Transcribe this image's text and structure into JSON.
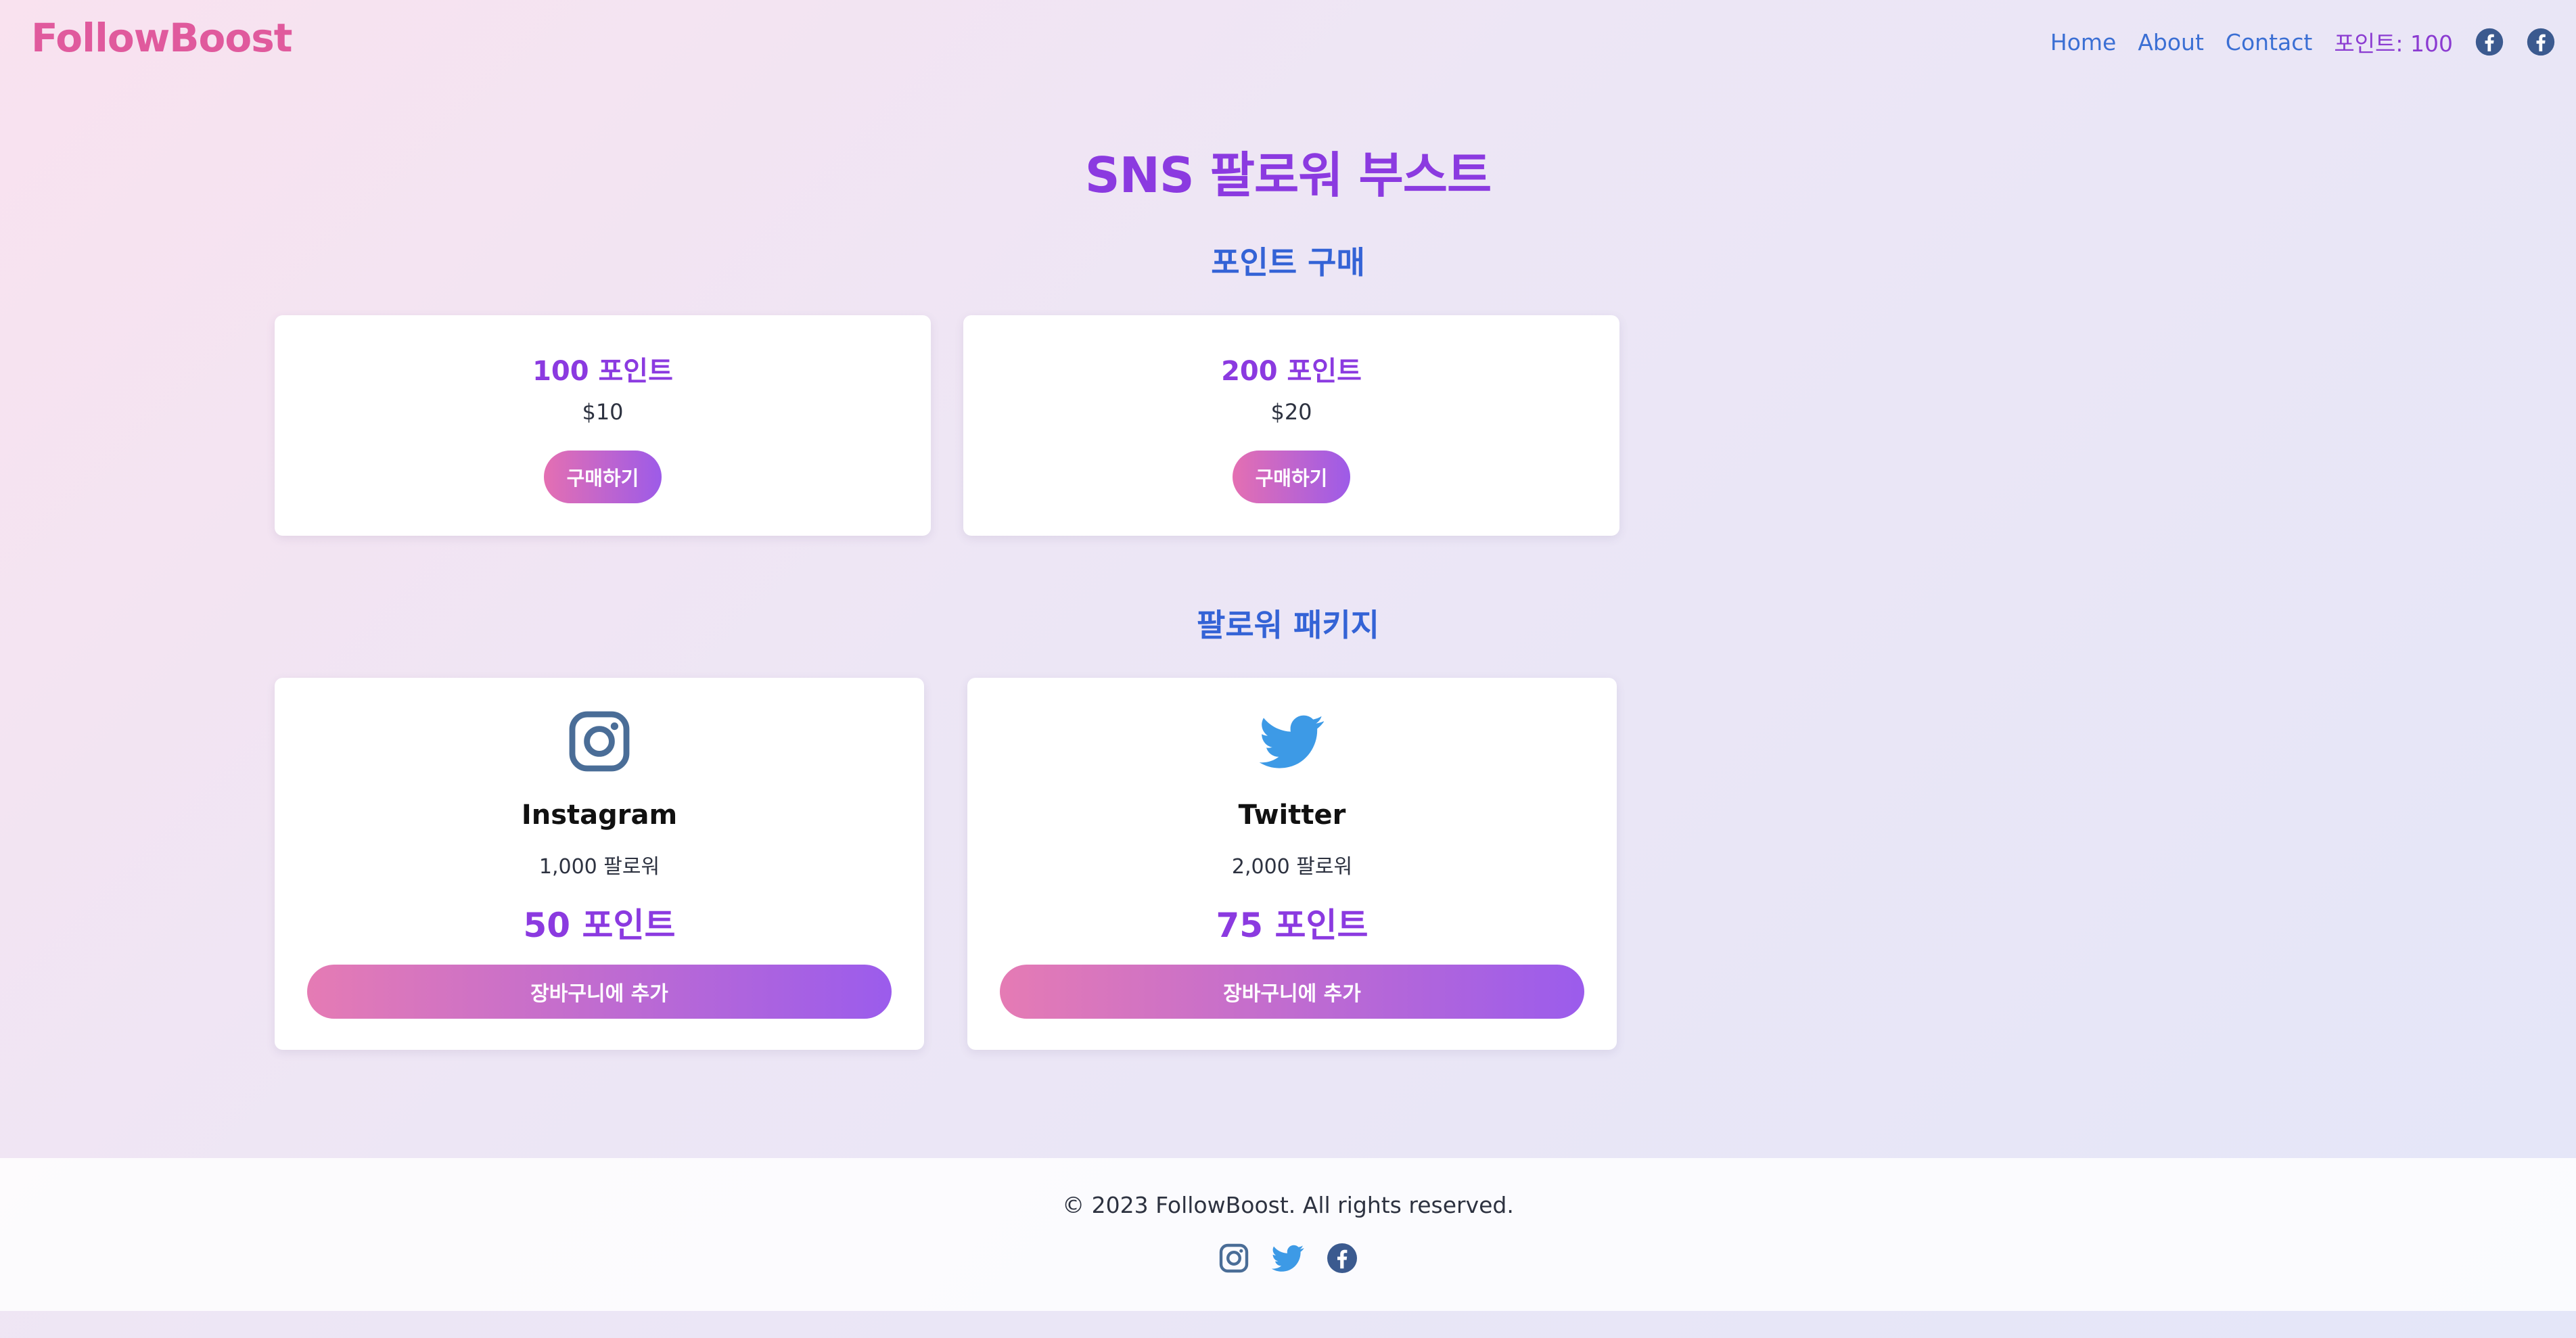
{
  "nav": {
    "logo": "FollowBoost",
    "links": [
      "Home",
      "About",
      "Contact"
    ],
    "points_label": "포인트: 100",
    "icons": [
      "facebook-icon",
      "facebook-icon"
    ]
  },
  "main": {
    "title": "SNS 팔로워 부스트",
    "points_section": {
      "title": "포인트 구매",
      "packages": [
        {
          "points": "100 포인트",
          "price": "$10",
          "button": "구매하기"
        },
        {
          "points": "200 포인트",
          "price": "$20",
          "button": "구매하기"
        }
      ]
    },
    "follower_section": {
      "title": "팔로워 패키지",
      "packages": [
        {
          "platform": "Instagram",
          "icon": "instagram-icon",
          "followers": "1,000 팔로워",
          "cost": "50 포인트",
          "button": "장바구니에 추가"
        },
        {
          "platform": "Twitter",
          "icon": "twitter-icon",
          "followers": "2,000 팔로워",
          "cost": "75 포인트",
          "button": "장바구니에 추가"
        }
      ]
    }
  },
  "footer": {
    "copyright": "© 2023 FollowBoost. All rights reserved.",
    "icons": [
      "instagram-icon",
      "twitter-icon",
      "facebook-icon"
    ]
  },
  "colors": {
    "brand": "#e05a9d",
    "accent_purple": "#8b3ae0",
    "section_blue": "#3463d6",
    "instagram": "#4a6d97",
    "twitter": "#3d9ae6",
    "facebook": "#3b5a8f",
    "button_gradient": [
      "#e46fb2",
      "#9d5be8"
    ]
  }
}
